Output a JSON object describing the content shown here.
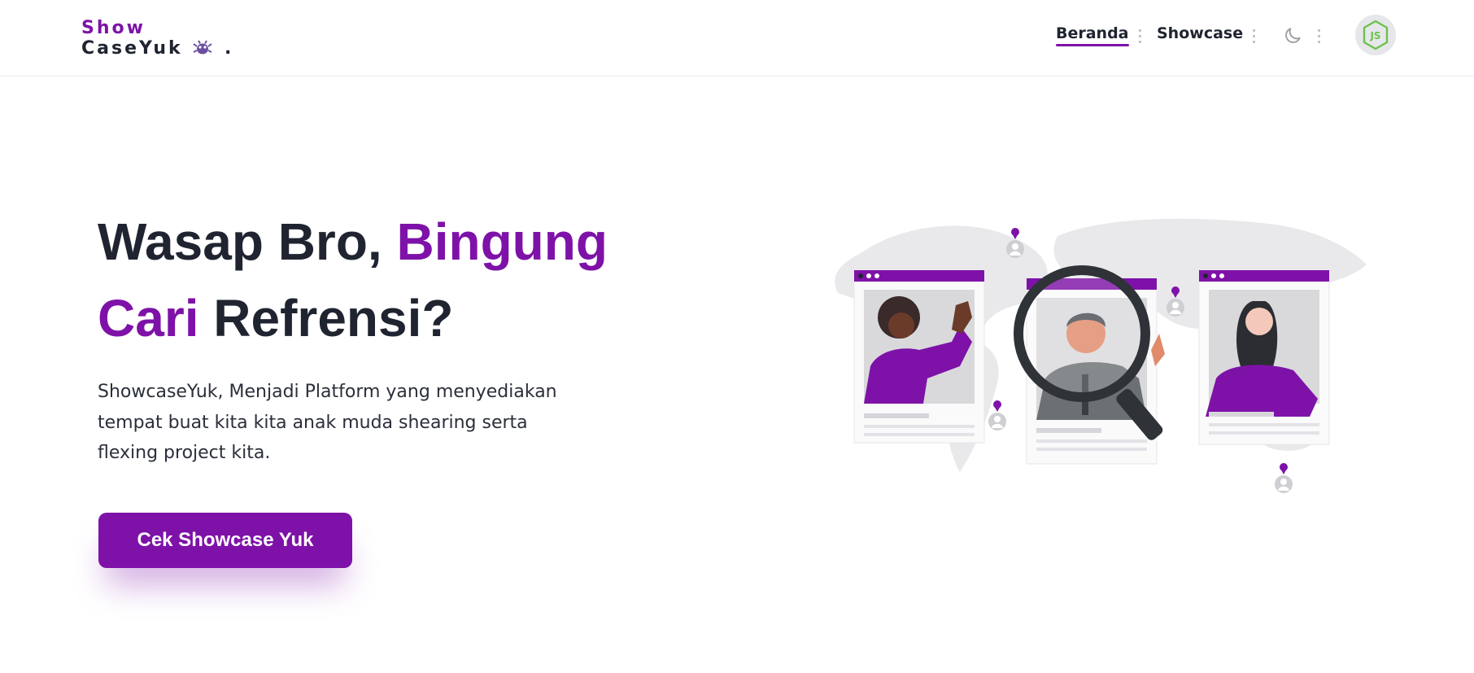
{
  "logo": {
    "line1": "Show",
    "line2": "CaseYuk",
    "dot": ".",
    "icon": "bug-icon"
  },
  "nav": {
    "items": [
      {
        "label": "Beranda",
        "active": true
      },
      {
        "label": "Showcase",
        "active": false
      }
    ],
    "theme_icon": "moon-icon",
    "avatar_icon": "nodejs-icon"
  },
  "hero": {
    "title_part1": "Wasap Bro, ",
    "title_part2": "Bingung",
    "title_part3": "Cari",
    "title_part4": " Refrensi?",
    "description": "ShowcaseYuk, Menjadi Platform yang menyediakan tempat buat kita kita anak muda shearing serta flexing project kita.",
    "cta_label": "Cek Showcase Yuk"
  },
  "colors": {
    "accent": "#7e12a8",
    "text": "#1f2430",
    "background": "#ffffff"
  }
}
